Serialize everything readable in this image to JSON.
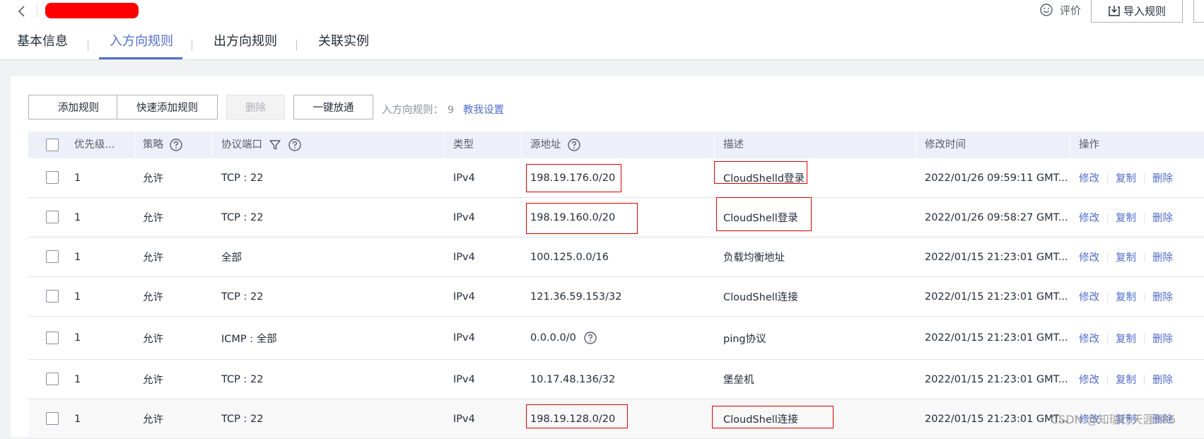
{
  "header": {
    "back_icon": "chevron-left-icon",
    "title_redacted_color": "#ff0000",
    "rate_label": "评价",
    "rate_icon": "smiley-icon",
    "import_button_label": "导入规则",
    "import_icon": "import-icon"
  },
  "tabs": [
    {
      "label": "基本信息",
      "active": false
    },
    {
      "label": "入方向规则",
      "active": true
    },
    {
      "label": "出方向规则",
      "active": false
    },
    {
      "label": "关联实例",
      "active": false
    }
  ],
  "toolbar": {
    "add_rule": "添加规则",
    "quick_add_rule": "快速添加规则",
    "delete": "删除",
    "one_click_open": "一键放通",
    "rule_count_label": "入方向规则：",
    "rule_count": "9",
    "teach_link": "教我设置"
  },
  "table": {
    "columns": {
      "priority": "优先级...",
      "policy": "策略",
      "protocol_port": "协议端口",
      "type": "类型",
      "source": "源地址",
      "description": "描述",
      "modified_time": "修改时间",
      "actions": "操作"
    },
    "row_actions": {
      "edit": "修改",
      "copy": "复制",
      "delete": "删除"
    },
    "rows": [
      {
        "priority": "1",
        "policy": "允许",
        "protocol_port": "TCP : 22",
        "type": "IPv4",
        "source": "198.19.176.0/20",
        "description": "CloudShelld登录",
        "modified_time": "2022/01/26 09:59:11 GMT..."
      },
      {
        "priority": "1",
        "policy": "允许",
        "protocol_port": "TCP : 22",
        "type": "IPv4",
        "source": "198.19.160.0/20",
        "description": "CloudShell登录",
        "modified_time": "2022/01/26 09:58:27 GMT..."
      },
      {
        "priority": "1",
        "policy": "允许",
        "protocol_port": "全部",
        "type": "IPv4",
        "source": "100.125.0.0/16",
        "description": "负载均衡地址",
        "modified_time": "2022/01/15 21:23:01 GMT..."
      },
      {
        "priority": "1",
        "policy": "允许",
        "protocol_port": "TCP : 22",
        "type": "IPv4",
        "source": "121.36.59.153/32",
        "description": "CloudShell连接",
        "modified_time": "2022/01/15 21:23:01 GMT..."
      },
      {
        "priority": "1",
        "policy": "允许",
        "protocol_port": "ICMP : 全部",
        "type": "IPv4",
        "source": "0.0.0.0/0",
        "description": "ping协议",
        "modified_time": "2022/01/15 21:23:01 GMT..."
      },
      {
        "priority": "1",
        "policy": "允许",
        "protocol_port": "TCP : 22",
        "type": "IPv4",
        "source": "10.17.48.136/32",
        "description": "堡垒机",
        "modified_time": "2022/01/15 21:23:01 GMT..."
      },
      {
        "priority": "1",
        "policy": "允许",
        "protocol_port": "TCP : 22",
        "type": "IPv4",
        "source": "198.19.128.0/20",
        "description": "CloudShell连接",
        "modified_time": "2022/01/15 21:23:01 GMT..."
      }
    ]
  },
  "annotation_color": "#e00000",
  "watermark": "CSDN @知瑞行天涯985"
}
